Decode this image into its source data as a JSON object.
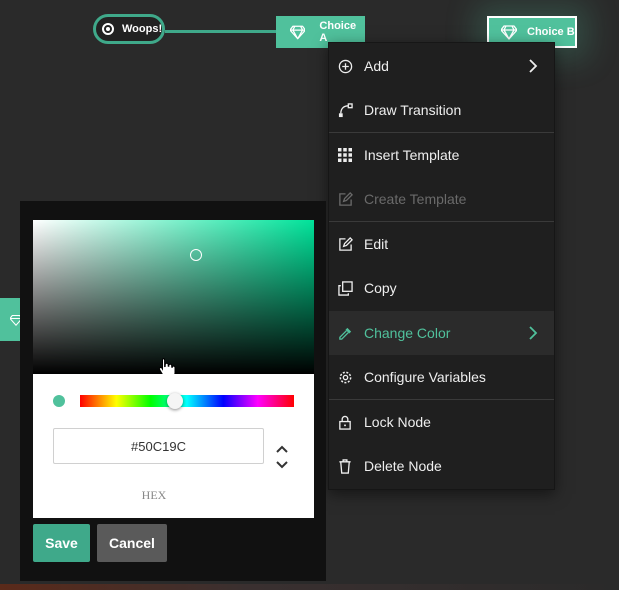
{
  "graph": {
    "start_node": {
      "label": "Woops!",
      "icon": "target-icon"
    },
    "choice_a": {
      "label": "Choice A",
      "icon": "gem-icon"
    },
    "choice_b": {
      "label": "Choice B",
      "icon": "gem-icon"
    }
  },
  "context_menu": {
    "items": [
      {
        "label": "Add",
        "icon": "plus-circle-icon"
      },
      {
        "label": "Draw Transition",
        "icon": "transition-icon"
      },
      {
        "label": "Insert Template",
        "icon": "grid-icon"
      },
      {
        "label": "Create Template",
        "icon": "edit-icon",
        "disabled": true
      },
      {
        "label": "Edit",
        "icon": "edit-icon"
      },
      {
        "label": "Copy",
        "icon": "copy-icon"
      },
      {
        "label": "Change Color",
        "icon": "eyedropper-icon",
        "active": true
      },
      {
        "label": "Configure Variables",
        "icon": "gear-icon"
      },
      {
        "label": "Lock Node",
        "icon": "lock-icon"
      },
      {
        "label": "Delete Node",
        "icon": "trash-icon"
      }
    ]
  },
  "color_picker": {
    "hex_value": "#50C19C",
    "mode_label": "HEX",
    "save_label": "Save",
    "cancel_label": "Cancel"
  },
  "colors": {
    "accent": "#50c19c",
    "accent_dark": "#3fa98a",
    "menu_bg": "#1f1f1f",
    "canvas_bg": "#2a2a2a"
  }
}
